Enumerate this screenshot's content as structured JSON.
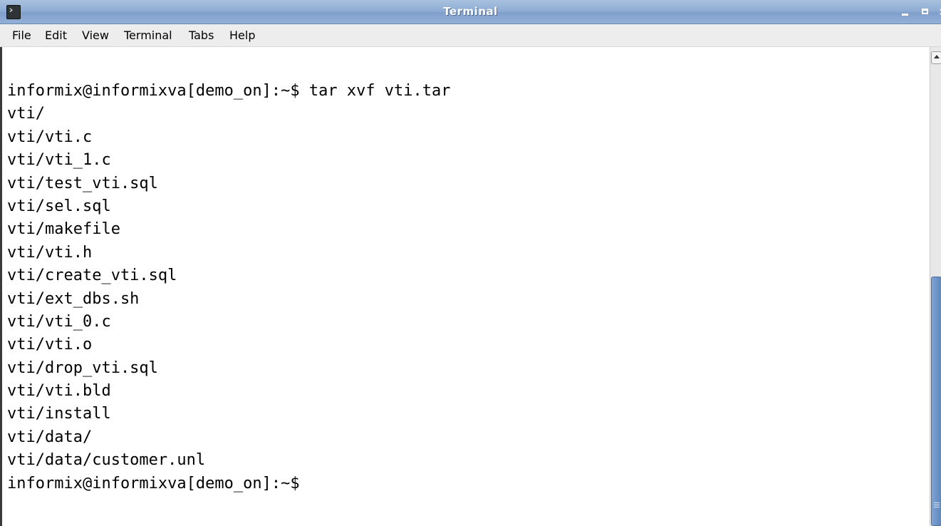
{
  "window": {
    "title": "Terminal",
    "icon": "terminal-icon",
    "controls": {
      "minimize_icon": "minimize-icon",
      "maximize_icon": "maximize-icon",
      "close_icon": "close-icon",
      "close_glyph": "×"
    }
  },
  "menubar": {
    "items": [
      "File",
      "Edit",
      "View",
      "Terminal",
      "Tabs",
      "Help"
    ]
  },
  "terminal": {
    "lines": [
      "informix@informixva[demo_on]:~$ tar xvf vti.tar",
      "vti/",
      "vti/vti.c",
      "vti/vti_1.c",
      "vti/test_vti.sql",
      "vti/sel.sql",
      "vti/makefile",
      "vti/vti.h",
      "vti/create_vti.sql",
      "vti/ext_dbs.sh",
      "vti/vti_0.c",
      "vti/vti.o",
      "vti/drop_vti.sql",
      "vti/vti.bld",
      "vti/install",
      "vti/data/",
      "vti/data/customer.unl",
      "informix@informixva[demo_on]:~$"
    ]
  },
  "colors": {
    "titlebar": "#8fadd4",
    "menubar": "#ededed",
    "terminal_bg": "#ffffff",
    "terminal_fg": "#000000",
    "scroll_thumb": "#6f95c8"
  }
}
